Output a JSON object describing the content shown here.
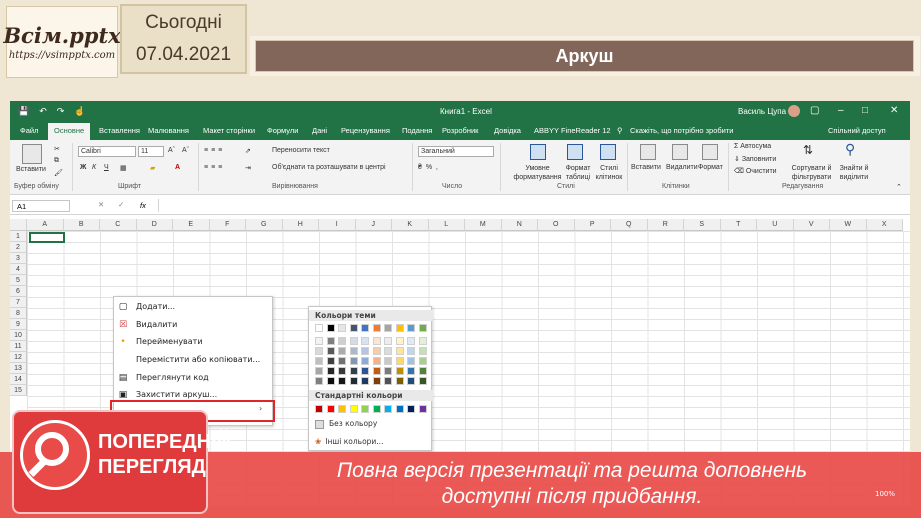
{
  "slide": {
    "logo_title": "Всім.pptx",
    "logo_url": "https://vsimpptx.com",
    "date_label": "Сьогодні",
    "date_value": "07.04.2021",
    "title": "Аркуш"
  },
  "excel": {
    "window_title": "Книга1 - Excel",
    "user_name": "Василь Цупа",
    "tabs": [
      "Файл",
      "Основне",
      "Вставлення",
      "Малювання",
      "Макет сторінки",
      "Формули",
      "Дані",
      "Рецензування",
      "Подання",
      "Розробник",
      "Довідка",
      "ABBYY FineReader 12"
    ],
    "active_tab": "Основне",
    "tell_me": "Скажіть, що потрібно зробити",
    "share": "Спільний доступ",
    "ribbon": {
      "paste": "Вставити",
      "clipboard_group": "Буфер обміну",
      "font_name": "Calibri",
      "font_size": "11",
      "font_group": "Шрифт",
      "wrap_text": "Переносити текст",
      "merge_center": "Об'єднати та розташувати в центрі",
      "alignment_group": "Вирівнювання",
      "number_format": "Загальний",
      "number_group": "Число",
      "conditional_formatting": "Умовне форматування",
      "format_as_table": "Формат таблиці",
      "cell_styles": "Стилі клітинок",
      "styles_group": "Стилі",
      "insert": "Вставити",
      "delete": "Видалити",
      "format": "Формат",
      "cells_group": "Клітинки",
      "autosum": "Автосума",
      "fill": "Заповнити",
      "clear": "Очистити",
      "sort_filter": "Сортувати й фільтрувати",
      "find_select": "Знайти й виділити",
      "editing_group": "Редагування"
    },
    "name_box": "A1",
    "fx_label": "fx",
    "columns": [
      "A",
      "B",
      "C",
      "D",
      "E",
      "F",
      "G",
      "H",
      "I",
      "J",
      "K",
      "L",
      "M",
      "N",
      "O",
      "P",
      "Q",
      "R",
      "S",
      "T",
      "U",
      "V",
      "W",
      "X"
    ],
    "rows": [
      "1",
      "2",
      "3",
      "4",
      "5",
      "6",
      "7",
      "8",
      "9",
      "10",
      "11",
      "12",
      "13",
      "14",
      "15"
    ],
    "context_menu": [
      "Додати...",
      "Видалити",
      "Перейменувати",
      "Перемістити або копіювати...",
      "Переглянути код",
      "Захистити аркуш..."
    ],
    "color_picker": {
      "theme_colors_label": "Кольори теми",
      "standard_colors_label": "Стандартні кольори",
      "no_color": "Без кольору",
      "more_colors": "Інші кольори..."
    },
    "zoom": "100%"
  },
  "colors": {
    "excel_green": "#217346",
    "banner_red": "#e84b48",
    "title_brown": "#82665a"
  },
  "watermark": {
    "badge_line1": "ПОПЕРЕДНІЙ",
    "badge_line2": "ПЕРЕГЛЯД",
    "text_line1": "Повна версія презентації та решта доповнень",
    "text_line2": "доступні після придбання."
  }
}
